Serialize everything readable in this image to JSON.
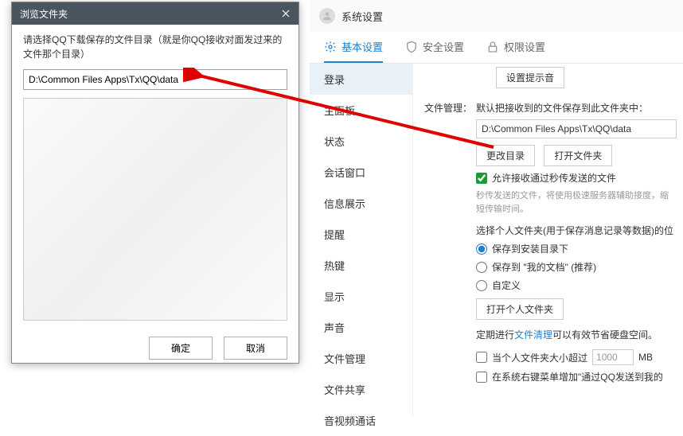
{
  "settings": {
    "title": "系统设置",
    "tabs": {
      "basic": "基本设置",
      "security": "安全设置",
      "permission": "权限设置"
    },
    "sidebar": [
      "登录",
      "主面板",
      "状态",
      "会话窗口",
      "信息展示",
      "提醒",
      "热键",
      "显示",
      "声音",
      "文件管理",
      "文件共享",
      "音视频通话"
    ],
    "tone_button": "设置提示音",
    "file_mgmt": {
      "label": "文件管理：",
      "default_save_text": "默认把接收到的文件保存到此文件夹中：",
      "path_value": "D:\\Common Files Apps\\Tx\\QQ\\data",
      "change_dir": "更改目录",
      "open_folder": "打开文件夹",
      "allow_sec": "允许接收通过秒传发送的文件",
      "sec_desc": "秒传发送的文件，将使用极速服务器辅助接度，缩短传输时间。",
      "personal_title": "选择个人文件夹(用于保存消息记录等数据)的位",
      "radio_install": "保存到安装目录下",
      "radio_docs": "保存到 \"我的文档\" (推荐)",
      "radio_custom": "自定义",
      "open_personal": "打开个人文件夹",
      "cleanup_prefix": "定期进行",
      "cleanup_link": "文件清理",
      "cleanup_suffix": "可以有效节省硬盘空间。",
      "size_prefix": "当个人文件夹大小超过",
      "size_value": "1000",
      "size_unit": "MB",
      "context_menu": "在系统右键菜单增加\"通过QQ发送到我的"
    }
  },
  "dialog": {
    "title": "浏览文件夹",
    "prompt": "请选择QQ下载保存的文件目录（就是你QQ接收对面发过来的文件那个目录）",
    "path_value": "D:\\Common Files Apps\\Tx\\QQ\\data",
    "ok": "确定",
    "cancel": "取消"
  }
}
